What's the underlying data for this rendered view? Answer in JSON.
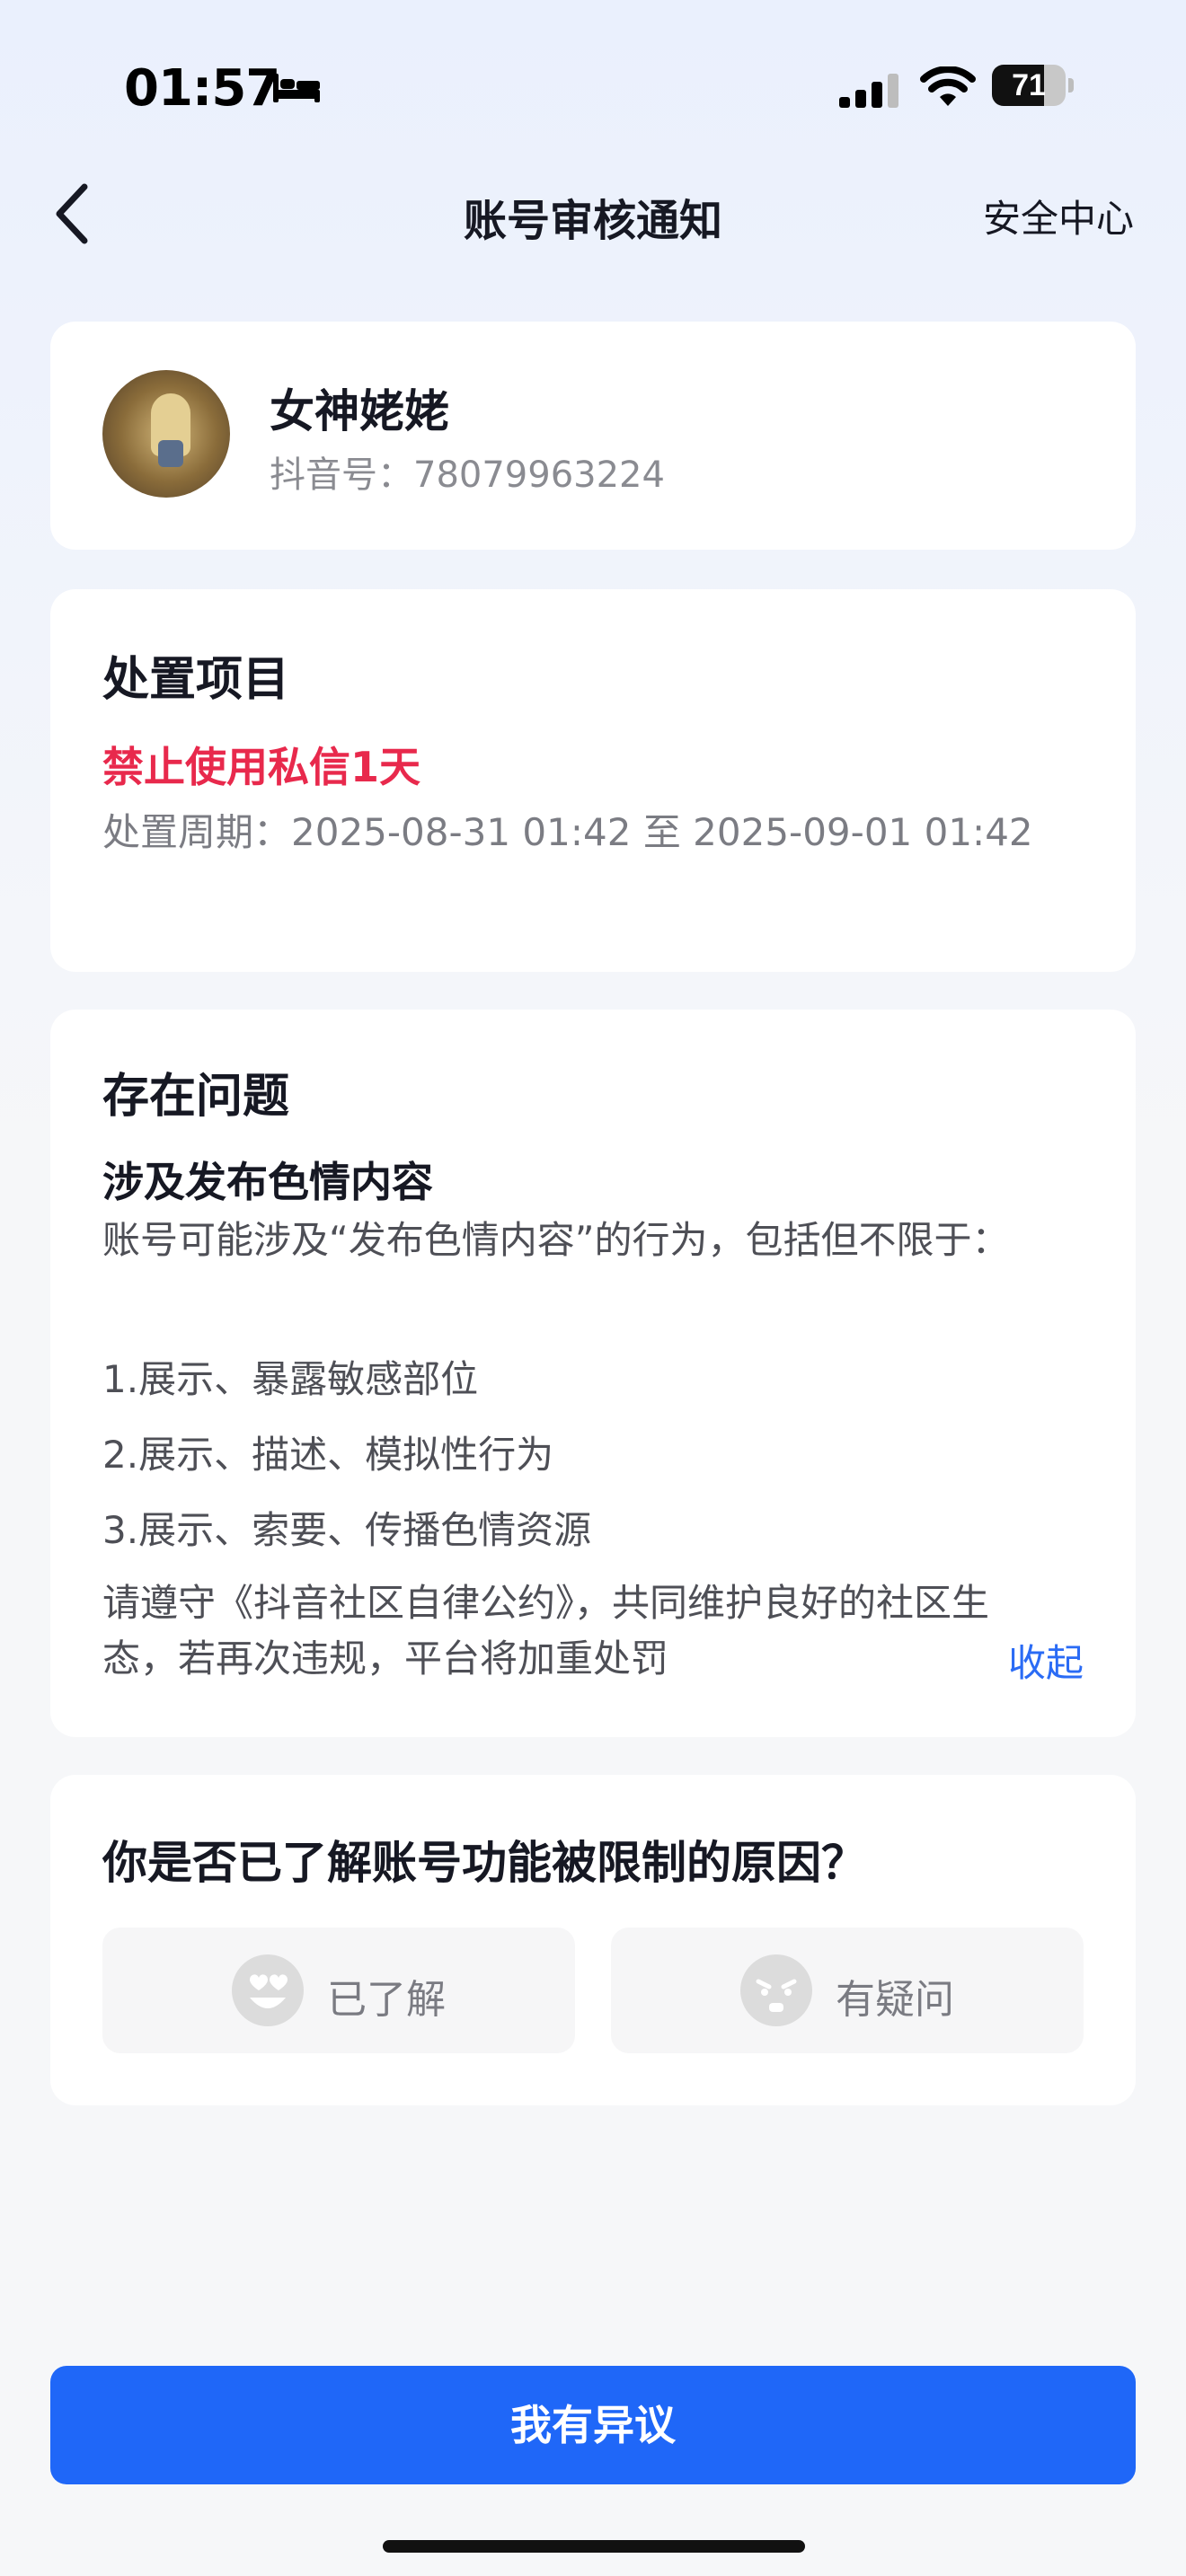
{
  "status_bar": {
    "time": "01:57",
    "battery": "71",
    "battery_level": 0.71
  },
  "nav": {
    "title": "账号审核通知",
    "right_link": "安全中心"
  },
  "profile": {
    "name": "女神姥姥",
    "douyin_id": "抖音号：78079963224"
  },
  "handling": {
    "title": "处置项目",
    "action": "禁止使用私信1天",
    "period": "处置周期：2025-08-31 01:42 至 2025-09-01 01:42"
  },
  "problem": {
    "title": "存在问题",
    "subtitle": "涉及发布色情内容",
    "description": "账号可能涉及“发布色情内容”的行为，包括但不限于：",
    "items": [
      "1.展示、暴露敏感部位",
      "2.展示、描述、模拟性行为",
      "3.展示、索要、传播色情资源"
    ],
    "footer": "请遵守《抖音社区自律公约》，共同维护良好的社区生态，若再次违规，平台将加重处罚",
    "collapse_label": "收起"
  },
  "question": {
    "title": "你是否已了解账号功能被限制的原因？",
    "options": [
      {
        "label": "已了解",
        "icon": "heart-eyes-emoji-icon"
      },
      {
        "label": "有疑问",
        "icon": "frowning-emoji-icon"
      }
    ]
  },
  "appeal_button": "我有异议",
  "colors": {
    "accent_blue": "#1f67f8",
    "alert_red": "#e8294c",
    "link_blue": "#2a6bf5"
  }
}
